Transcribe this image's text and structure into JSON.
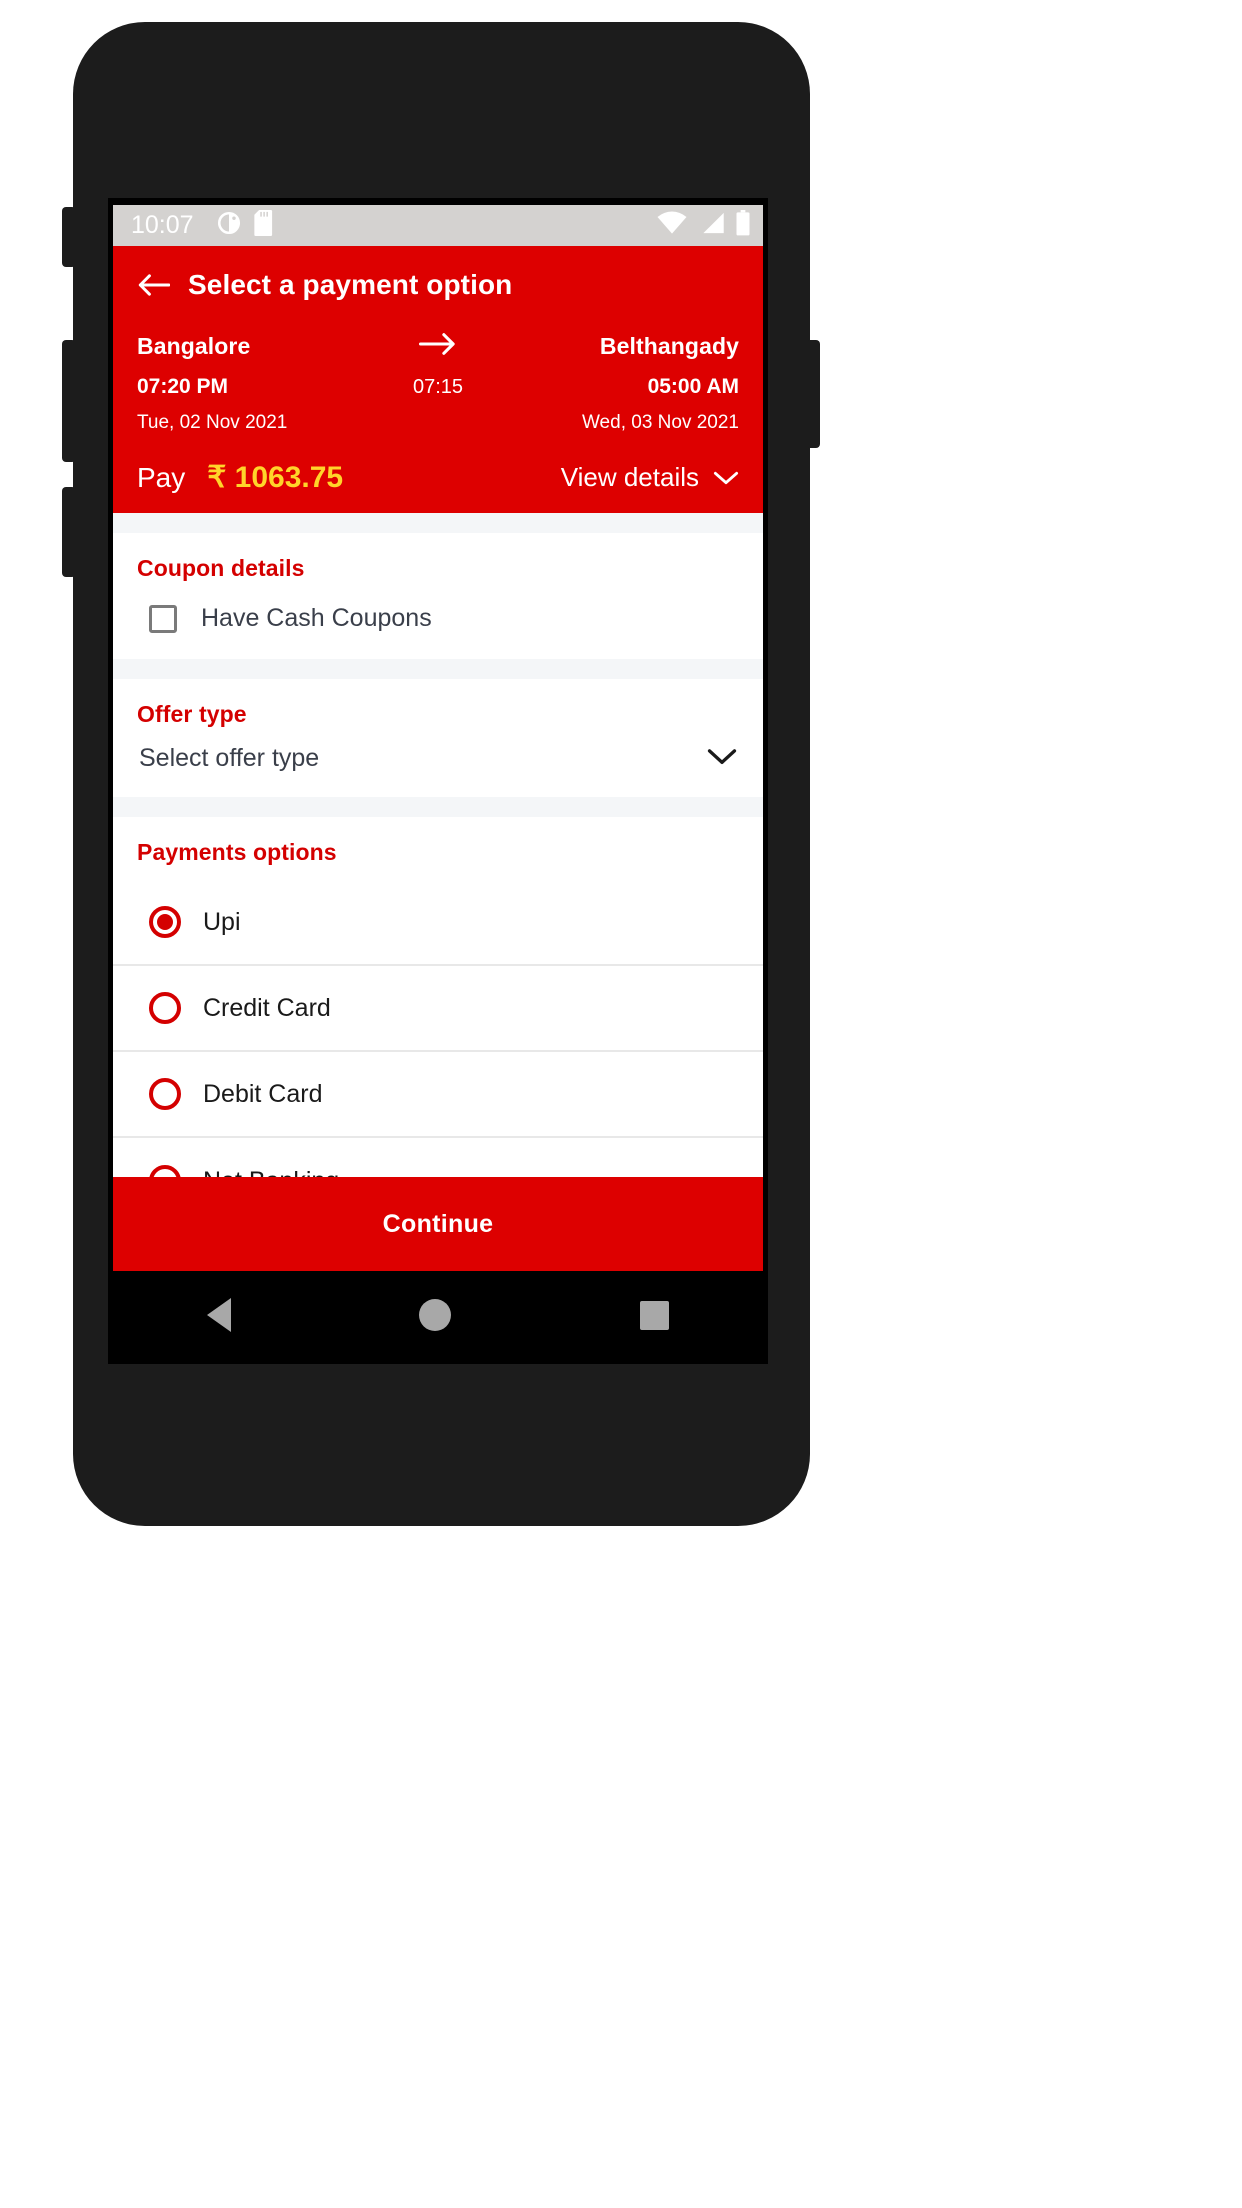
{
  "statusbar": {
    "time": "10:07",
    "left_icons": [
      "do-not-disturb-icon",
      "sd-card-icon"
    ],
    "right_icons": [
      "wifi-icon",
      "cellular-signal-icon",
      "battery-icon"
    ]
  },
  "header": {
    "back_icon": "back-arrow-icon",
    "title": "Select a payment option",
    "accent_color": "#dd0000",
    "journey": {
      "origin": "Bangalore",
      "destination": "Belthangady",
      "arrow_icon": "arrow-right-icon",
      "departure_time": "07:20 PM",
      "arrival_time": "05:00 AM",
      "duration": "07:15",
      "departure_date": "Tue, 02 Nov 2021",
      "arrival_date": "Wed, 03 Nov 2021"
    },
    "pay": {
      "label": "Pay",
      "amount": "₹ 1063.75",
      "amount_color": "#ffd42a",
      "view_details": "View details",
      "chevron_icon": "chevron-down-icon"
    }
  },
  "coupon": {
    "title": "Coupon details",
    "checkbox_label": "Have Cash Coupons",
    "checked": false
  },
  "offer": {
    "title": "Offer type",
    "selected_value": "Select offer type",
    "chevron_icon": "chevron-down-icon"
  },
  "payments": {
    "title": "Payments options",
    "options": [
      {
        "label": "Upi",
        "selected": true
      },
      {
        "label": "Credit Card",
        "selected": false
      },
      {
        "label": "Debit Card",
        "selected": false
      },
      {
        "label": "Net Banking",
        "selected": false
      }
    ]
  },
  "footer": {
    "continue_label": "Continue"
  },
  "navbar": {
    "back": "nav-back-icon",
    "home": "nav-home-icon",
    "recents": "nav-recents-icon"
  }
}
